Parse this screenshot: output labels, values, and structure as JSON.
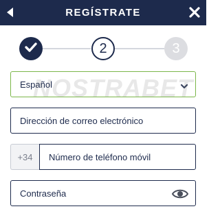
{
  "header": {
    "title": "REGÍSTRATE",
    "back_icon": "back-arrow-icon",
    "close_icon": "close-icon",
    "background": "#1d2a4c"
  },
  "stepper": {
    "steps": [
      {
        "label": "",
        "state": "done",
        "icon": "check-icon"
      },
      {
        "label": "2",
        "state": "active"
      },
      {
        "label": "3",
        "state": "todo"
      }
    ],
    "current_step": 2,
    "accent": "#1d2a4c"
  },
  "form": {
    "language": {
      "value": "Español",
      "icon": "chevron-down-icon",
      "border_color": "#7ab648"
    },
    "email": {
      "placeholder": "Dirección de correo electrónico"
    },
    "phone": {
      "prefix": "+34",
      "placeholder": "Número de teléfono móvil"
    },
    "password": {
      "placeholder": "Contraseña",
      "icon": "eye-icon"
    }
  },
  "watermark": {
    "text": "NOSTRABET"
  }
}
